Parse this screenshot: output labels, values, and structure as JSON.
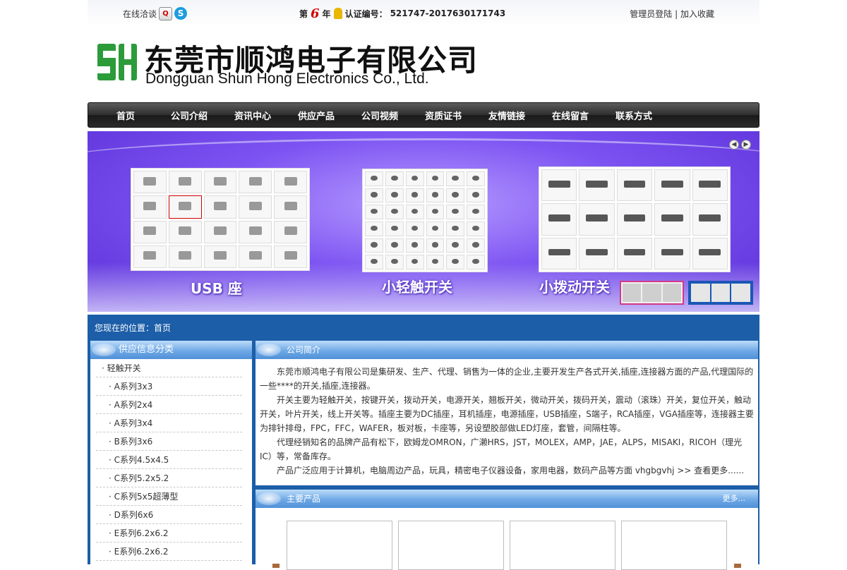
{
  "topbar": {
    "online_chat": "在线洽谈",
    "year_prefix": "第",
    "year_num": "6",
    "year_suffix": "年",
    "cert_label": "认证编号：",
    "cert_number": "521747-2017630171743",
    "admin_login": "管理员登陆",
    "separator": "|",
    "bookmark": "加入收藏"
  },
  "logo": {
    "mark_text": "SH",
    "cn_name": "东莞市顺鸿电子有限公司",
    "en_name": "Dongguan Shun Hong Electronics Co., Ltd."
  },
  "nav": {
    "items": [
      "首页",
      "公司介绍",
      "资讯中心",
      "供应产品",
      "公司视频",
      "资质证书",
      "友情链接",
      "在线留言",
      "联系方式"
    ]
  },
  "banner": {
    "labels": [
      "USB 座",
      "小轻触开关",
      "小拨动开关"
    ]
  },
  "breadcrumb": {
    "label": "您现在的位置：",
    "current": "首页"
  },
  "sidebar": {
    "title": "供应信息分类",
    "items": [
      {
        "label": "· 轻触开关"
      },
      {
        "label": "· A系列3x3"
      },
      {
        "label": "· A系列2x4"
      },
      {
        "label": "· A系列3x4"
      },
      {
        "label": "· B系列3x6"
      },
      {
        "label": "· C系列4.5x4.5"
      },
      {
        "label": "· C系列5.2x5.2"
      },
      {
        "label": "· C系列5x5超薄型"
      },
      {
        "label": "· D系列6x6"
      },
      {
        "label": "· E系列6.2x6.2"
      },
      {
        "label": "· E系列6.2x6.2"
      }
    ]
  },
  "intro": {
    "title": "公司简介",
    "p1": "东莞市顺鸿电子有限公司是集研发、生产、代理、销售为一体的企业,主要开发生产各式开关,插座,连接器方面的产品,代理国际的一些****的开关,插座,连接器。",
    "p2": "开关主要为轻触开关，按键开关，拨动开关，电源开关，翘板开关，微动开关，拨码开关，震动（滚珠）开关，复位开关，触动开关，叶片开关，线上开关等。插座主要为DC插座，耳机插座，电源插座，USB插座，S端子，RCA插座，VGA插座等，连接器主要为排针排母，FPC，FFC，WAFER，板对板，卡座等，另设塑胶部做LED灯座，套管，间隔柱等。",
    "p3": "代理经销知名的品牌产品有松下，欧姆龙OMRON，广濑HRS，JST，MOLEX，AMP，JAE，ALPS，MISAKI，RICOH（理光IC）等，常备库存。",
    "p4": "产品广泛应用于计算机，电脑周边产品，玩具，精密电子仪器设备，家用电器，数码产品等方面 vhgbgvhj",
    "more": ">> 查看更多......"
  },
  "products": {
    "title": "主要产品",
    "more": "更多..."
  },
  "colors": {
    "main_blue": "#1c5ea8",
    "nav_dark": "#2e2e2e",
    "banner_purple": "#7d54f2",
    "logo_green": "#2c9b3a",
    "cert_red": "#d40000"
  }
}
